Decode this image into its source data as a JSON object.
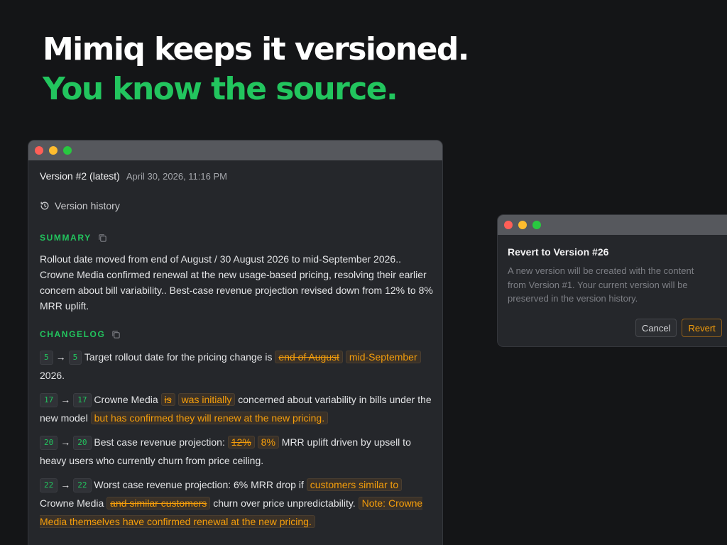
{
  "headline": {
    "line1": "Mimiq keeps it versioned.",
    "line2": "You know the source."
  },
  "colors": {
    "accent_green": "#22c55e",
    "change_orange": "#f59e0b",
    "background": "#141517"
  },
  "main_window": {
    "version_title": "Version #2 (latest)",
    "version_date": "April 30, 2026, 11:16 PM",
    "history_label": "Version history",
    "history_icon": "history-icon",
    "summary_label": "SUMMARY",
    "summary_text": "Rollout date moved from end of August / 30 August 2026 to mid-September 2026.. Crowne Media confirmed renewal at the new usage-based pricing, resolving their earlier concern about bill variability.. Best-case revenue projection revised down from 12% to 8% MRR uplift.",
    "copy_icon": "copy-icon",
    "changelog_label": "CHANGELOG",
    "entries": [
      {
        "from": "5",
        "to": "5",
        "t1": "Target rollout date for the pricing change is ",
        "del1": "end of August",
        "ins1": "mid-September",
        "t2": " 2026."
      },
      {
        "from": "17",
        "to": "17",
        "t1": "Crowne Media ",
        "del1": "is",
        "ins1": "was initially",
        "t2": " concerned about variability in bills under the new model ",
        "ins2": "but has confirmed they will renew at the new pricing."
      },
      {
        "from": "20",
        "to": "20",
        "t1": "Best case revenue projection: ",
        "del1": "12%",
        "ins1": "8%",
        "t2": " MRR uplift driven by upsell to heavy users who currently churn from price ceiling."
      },
      {
        "from": "22",
        "to": "22",
        "t1": "Worst case revenue projection: 6% MRR drop if ",
        "ins1": "customers similar to",
        "t2": " Crowne Media ",
        "del1": "and similar customers",
        "t3": " churn over price unpredictability. ",
        "ins2": "Note: Crowne Media themselves have confirmed renewal at the new pricing."
      }
    ]
  },
  "dialog": {
    "title": "Revert to Version #26",
    "text": "A new version will be created with the content from Version #1. Your current version will be preserved in the version history.",
    "cancel_label": "Cancel",
    "revert_label": "Revert"
  }
}
